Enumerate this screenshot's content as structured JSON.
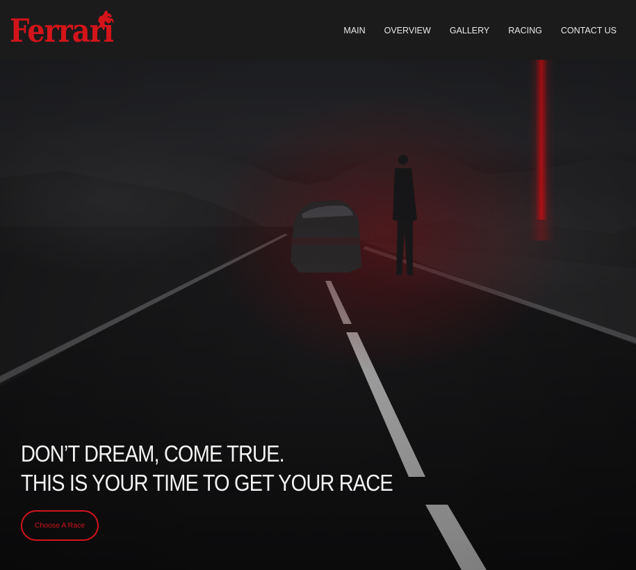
{
  "brand": {
    "logo_text": "Ferrari",
    "logo_icon": "prancing-horse-icon",
    "brand_color": "#d3141b"
  },
  "nav": {
    "items": [
      {
        "label": "MAIN"
      },
      {
        "label": "OVERVIEW"
      },
      {
        "label": "GALLERY"
      },
      {
        "label": "RACING"
      },
      {
        "label": "CONTACT US"
      }
    ]
  },
  "hero": {
    "headline_line1": "DON’T DREAM, COME TRUE.",
    "headline_line2": "THIS IS YOUR TIME TO GET YOUR RACE",
    "cta_label": "Choose A Race"
  }
}
